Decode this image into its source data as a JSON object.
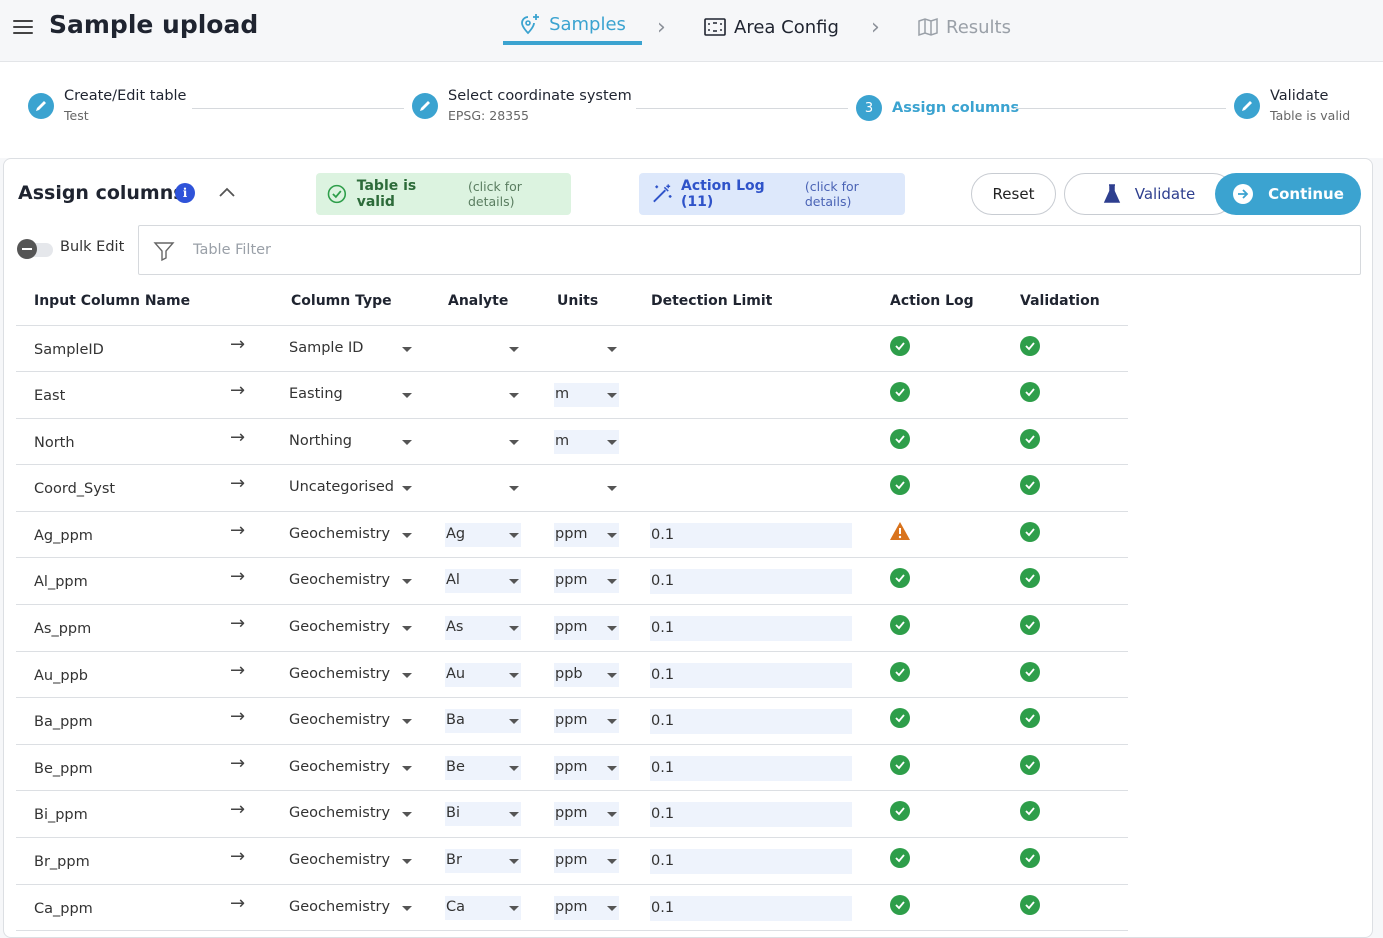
{
  "header": {
    "title": "Sample upload",
    "tabs": [
      {
        "label": "Samples",
        "icon": "sparkle-pin-icon",
        "state": "active"
      },
      {
        "label": "Area Config",
        "icon": "area-frame-icon",
        "state": "normal"
      },
      {
        "label": "Results",
        "icon": "map-icon",
        "state": "disabled"
      }
    ]
  },
  "stepper": {
    "steps": [
      {
        "title": "Create/Edit table",
        "subtitle": "Test",
        "icon": "pencil-icon"
      },
      {
        "title": "Select coordinate system",
        "subtitle": "EPSG: 28355",
        "icon": "pencil-icon"
      },
      {
        "title": "Assign columns",
        "subtitle": "",
        "number": "3",
        "state": "active"
      },
      {
        "title": "Validate",
        "subtitle": "Table is valid",
        "icon": "pencil-icon"
      }
    ]
  },
  "panel": {
    "title": "Assign columns",
    "valid_status": {
      "message": "Table is valid",
      "detail": "(click for details)"
    },
    "action_log": {
      "message": "Action Log (11)",
      "detail": "(click for details)"
    },
    "buttons": {
      "reset": "Reset",
      "validate": "Validate",
      "continue": "Continue"
    },
    "bulk_edit_label": "Bulk Edit",
    "filter_placeholder": "Table Filter"
  },
  "table": {
    "headers": [
      "Input Column Name",
      "Column Type",
      "Analyte",
      "Units",
      "Detection Limit",
      "Action Log",
      "Validation"
    ],
    "rows": [
      {
        "name": "SampleID",
        "type": "Sample ID",
        "analyte": "",
        "units": "",
        "detection": "",
        "action_log": "ok",
        "validation": "ok"
      },
      {
        "name": "East",
        "type": "Easting",
        "analyte": "",
        "units": "m",
        "detection": "",
        "action_log": "ok",
        "validation": "ok"
      },
      {
        "name": "North",
        "type": "Northing",
        "analyte": "",
        "units": "m",
        "detection": "",
        "action_log": "ok",
        "validation": "ok"
      },
      {
        "name": "Coord_Syst",
        "type": "Uncategorised",
        "analyte": "",
        "units": "",
        "detection": "",
        "action_log": "ok",
        "validation": "ok"
      },
      {
        "name": "Ag_ppm",
        "type": "Geochemistry",
        "analyte": "Ag",
        "units": "ppm",
        "detection": "0.1",
        "action_log": "warning",
        "validation": "ok"
      },
      {
        "name": "Al_ppm",
        "type": "Geochemistry",
        "analyte": "Al",
        "units": "ppm",
        "detection": "0.1",
        "action_log": "ok",
        "validation": "ok"
      },
      {
        "name": "As_ppm",
        "type": "Geochemistry",
        "analyte": "As",
        "units": "ppm",
        "detection": "0.1",
        "action_log": "ok",
        "validation": "ok"
      },
      {
        "name": "Au_ppb",
        "type": "Geochemistry",
        "analyte": "Au",
        "units": "ppb",
        "detection": "0.1",
        "action_log": "ok",
        "validation": "ok"
      },
      {
        "name": "Ba_ppm",
        "type": "Geochemistry",
        "analyte": "Ba",
        "units": "ppm",
        "detection": "0.1",
        "action_log": "ok",
        "validation": "ok"
      },
      {
        "name": "Be_ppm",
        "type": "Geochemistry",
        "analyte": "Be",
        "units": "ppm",
        "detection": "0.1",
        "action_log": "ok",
        "validation": "ok"
      },
      {
        "name": "Bi_ppm",
        "type": "Geochemistry",
        "analyte": "Bi",
        "units": "ppm",
        "detection": "0.1",
        "action_log": "ok",
        "validation": "ok"
      },
      {
        "name": "Br_ppm",
        "type": "Geochemistry",
        "analyte": "Br",
        "units": "ppm",
        "detection": "0.1",
        "action_log": "ok",
        "validation": "ok"
      },
      {
        "name": "Ca_ppm",
        "type": "Geochemistry",
        "analyte": "Ca",
        "units": "ppm",
        "detection": "0.1",
        "action_log": "ok",
        "validation": "ok"
      }
    ]
  },
  "colors": {
    "accent": "#3ba3d0",
    "success": "#2e9e4a",
    "warning": "#d9731c",
    "info": "#2f53d9"
  }
}
